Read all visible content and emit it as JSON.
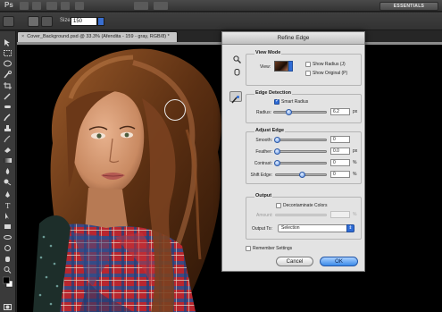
{
  "app": {
    "logo": "Ps",
    "workspace_button": "ESSENTIALS"
  },
  "options_bar": {
    "size_label": "Size:",
    "size_value": "150"
  },
  "document": {
    "tab_title": "Cover_Background.psd @ 33.3% (Afendita - 159 - gray, RGB/8) *",
    "close_glyph": "×"
  },
  "refine_edge": {
    "title": "Refine Edge",
    "view_mode": {
      "section": "View Mode",
      "view_label": "View:",
      "show_radius": "Show Radius (J)",
      "show_original": "Show Original (P)"
    },
    "edge_detection": {
      "section": "Edge Detection",
      "smart_radius": "Smart Radius",
      "smart_radius_checked": true,
      "radius_label": "Radius:",
      "radius_value": "6.2",
      "radius_unit": "px",
      "radius_fraction": 0.28
    },
    "adjust_edge": {
      "section": "Adjust Edge",
      "rows": [
        {
          "label": "Smooth:",
          "value": "0",
          "unit": "",
          "fraction": 0.0
        },
        {
          "label": "Feather:",
          "value": "0.0",
          "unit": "px",
          "fraction": 0.0
        },
        {
          "label": "Contrast:",
          "value": "0",
          "unit": "%",
          "fraction": 0.0
        },
        {
          "label": "Shift Edge:",
          "value": "0",
          "unit": "%",
          "fraction": 0.5
        }
      ]
    },
    "output": {
      "section": "Output",
      "decontaminate": "Decontaminate Colors",
      "amount_label": "Amount:",
      "amount_unit": "%",
      "output_to_label": "Output To:",
      "output_to_value": "Selection",
      "select_arrow": "⇕"
    },
    "remember_settings": "Remember Settings",
    "cancel_label": "Cancel",
    "ok_label": "OK"
  },
  "colors": {
    "accent": "#2f6cd6",
    "ok_button": "#3c8ae8",
    "dialog_bg": "#e3e3e3"
  }
}
